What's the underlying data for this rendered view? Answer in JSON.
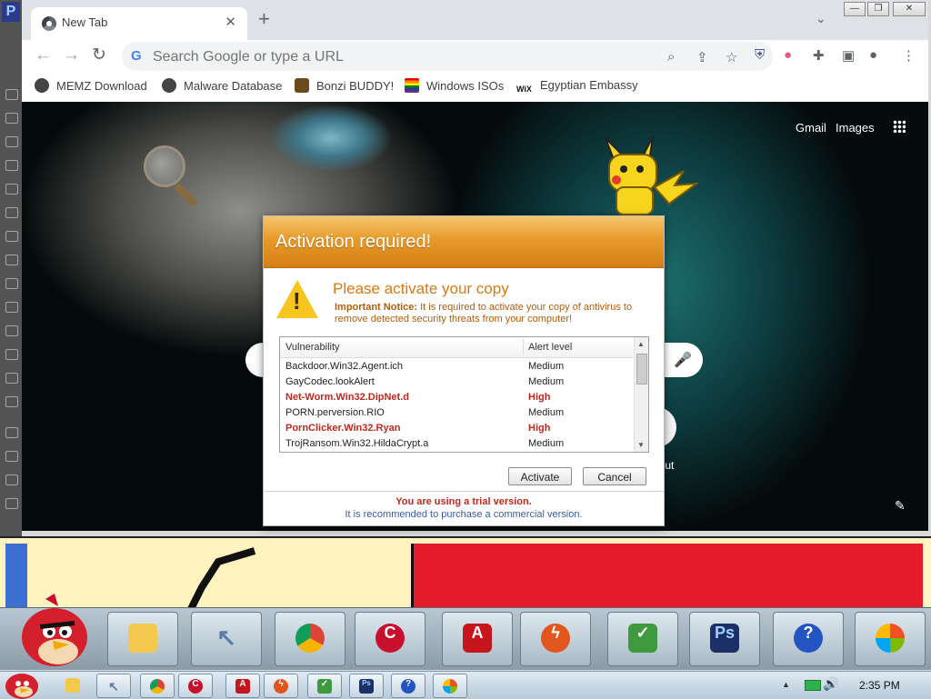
{
  "browser": {
    "tab_title": "New Tab",
    "tab_close": "✕",
    "new_tab": "+",
    "tab_menu": "⌄",
    "window_controls": [
      "—",
      "❐",
      "✕"
    ],
    "address_placeholder": "Search Google or type a URL",
    "bookmarks": [
      "MEMZ Download",
      "Malware Database",
      "Bonzi BUDDY!",
      "Windows ISOs",
      "Egyptian Embassy"
    ]
  },
  "newtab": {
    "gmail": "Gmail",
    "images": "Images",
    "shortcut_label": "rtcut"
  },
  "dialog": {
    "title": "Activation required!",
    "heading": "Please activate your copy",
    "notice_bold": "Important Notice:",
    "notice_text": " It is required to activate your copy of antivirus to remove detected security threats from your computer!",
    "columns": [
      "Vulnerability",
      "Alert level"
    ],
    "rows": [
      {
        "name": "Backdoor.Win32.Agent.ich",
        "level": "Medium",
        "high": false
      },
      {
        "name": "GayCodec.lookAlert",
        "level": "Medium",
        "high": false
      },
      {
        "name": "Net-Worm.Win32.DipNet.d",
        "level": "High",
        "high": true
      },
      {
        "name": "PORN.perversion.RIO",
        "level": "Medium",
        "high": false
      },
      {
        "name": "PornClicker.Win32.Ryan",
        "level": "High",
        "high": true
      },
      {
        "name": "TrojRansom.Win32.HildaCrypt.a",
        "level": "Medium",
        "high": false
      }
    ],
    "activate": "Activate",
    "cancel": "Cancel",
    "trial": "You are using a trial version.",
    "recommend": "It is recommended to purchase a commercial version."
  },
  "taskbar": {
    "clock": "2:35 PM"
  },
  "colors": {
    "dialog_header": "#e79a2a",
    "high_alert": "#c0281e",
    "wallpaper_red": "#e51b2b",
    "wallpaper_yellow": "#fff4bf"
  }
}
